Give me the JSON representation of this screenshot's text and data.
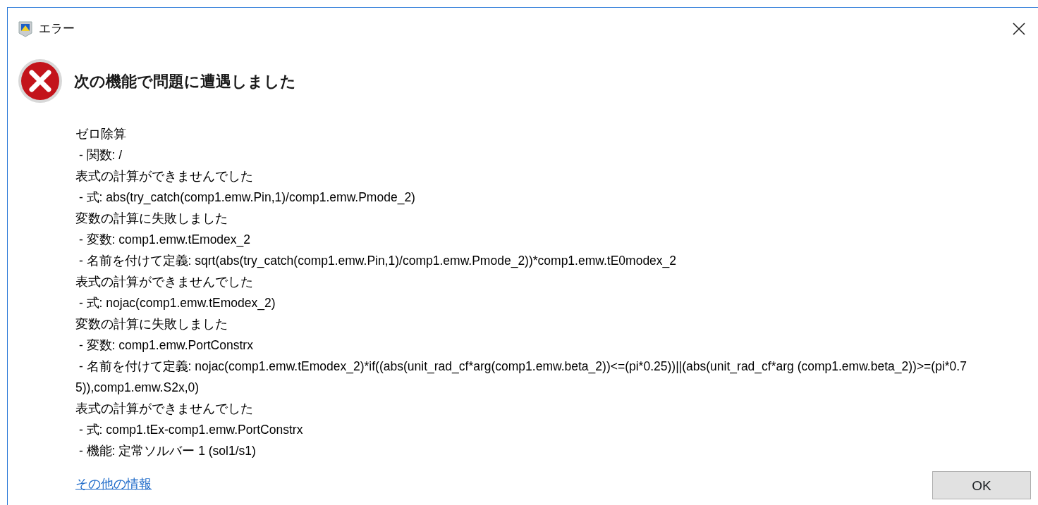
{
  "window": {
    "title": "エラー"
  },
  "heading": "次の機能で問題に遭遇しました",
  "message_lines": [
    "ゼロ除算",
    " - 関数: /",
    "表式の計算ができませんでした",
    " - 式: abs(try_catch(comp1.emw.Pin,1)/comp1.emw.Pmode_2)",
    "変数の計算に失敗しました",
    " - 変数: comp1.emw.tEmodex_2",
    " - 名前を付けて定義: sqrt(abs(try_catch(comp1.emw.Pin,1)/comp1.emw.Pmode_2))*comp1.emw.tE0modex_2",
    "表式の計算ができませんでした",
    " - 式: nojac(comp1.emw.tEmodex_2)",
    "変数の計算に失敗しました",
    " - 変数: comp1.emw.PortConstrx",
    " - 名前を付けて定義: nojac(comp1.emw.tEmodex_2)*if((abs(unit_rad_cf*arg(comp1.emw.beta_2))<=(pi*0.25))||(abs(unit_rad_cf*arg (comp1.emw.beta_2))>=(pi*0.75)),comp1.emw.S2x,0)",
    "表式の計算ができませんでした",
    " - 式: comp1.tEx-comp1.emw.PortConstrx",
    " - 機能: 定常ソルバー 1 (sol1/s1)"
  ],
  "details_link": "その他の情報",
  "buttons": [
    "OK"
  ]
}
